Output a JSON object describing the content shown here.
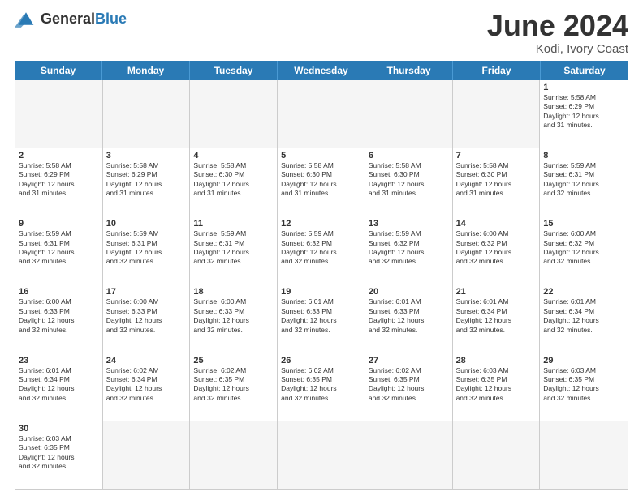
{
  "header": {
    "logo_general": "General",
    "logo_blue": "Blue",
    "month_title": "June 2024",
    "location": "Kodi, Ivory Coast"
  },
  "days_of_week": [
    "Sunday",
    "Monday",
    "Tuesday",
    "Wednesday",
    "Thursday",
    "Friday",
    "Saturday"
  ],
  "rows": [
    [
      {
        "day": "",
        "info": "",
        "empty": true
      },
      {
        "day": "",
        "info": "",
        "empty": true
      },
      {
        "day": "",
        "info": "",
        "empty": true
      },
      {
        "day": "",
        "info": "",
        "empty": true
      },
      {
        "day": "",
        "info": "",
        "empty": true
      },
      {
        "day": "",
        "info": "",
        "empty": true
      },
      {
        "day": "1",
        "info": "Sunrise: 5:58 AM\nSunset: 6:29 PM\nDaylight: 12 hours\nand 31 minutes.",
        "empty": false
      }
    ],
    [
      {
        "day": "2",
        "info": "Sunrise: 5:58 AM\nSunset: 6:29 PM\nDaylight: 12 hours\nand 31 minutes.",
        "empty": false
      },
      {
        "day": "3",
        "info": "Sunrise: 5:58 AM\nSunset: 6:29 PM\nDaylight: 12 hours\nand 31 minutes.",
        "empty": false
      },
      {
        "day": "4",
        "info": "Sunrise: 5:58 AM\nSunset: 6:30 PM\nDaylight: 12 hours\nand 31 minutes.",
        "empty": false
      },
      {
        "day": "5",
        "info": "Sunrise: 5:58 AM\nSunset: 6:30 PM\nDaylight: 12 hours\nand 31 minutes.",
        "empty": false
      },
      {
        "day": "6",
        "info": "Sunrise: 5:58 AM\nSunset: 6:30 PM\nDaylight: 12 hours\nand 31 minutes.",
        "empty": false
      },
      {
        "day": "7",
        "info": "Sunrise: 5:58 AM\nSunset: 6:30 PM\nDaylight: 12 hours\nand 31 minutes.",
        "empty": false
      },
      {
        "day": "8",
        "info": "Sunrise: 5:59 AM\nSunset: 6:31 PM\nDaylight: 12 hours\nand 32 minutes.",
        "empty": false
      }
    ],
    [
      {
        "day": "9",
        "info": "Sunrise: 5:59 AM\nSunset: 6:31 PM\nDaylight: 12 hours\nand 32 minutes.",
        "empty": false
      },
      {
        "day": "10",
        "info": "Sunrise: 5:59 AM\nSunset: 6:31 PM\nDaylight: 12 hours\nand 32 minutes.",
        "empty": false
      },
      {
        "day": "11",
        "info": "Sunrise: 5:59 AM\nSunset: 6:31 PM\nDaylight: 12 hours\nand 32 minutes.",
        "empty": false
      },
      {
        "day": "12",
        "info": "Sunrise: 5:59 AM\nSunset: 6:32 PM\nDaylight: 12 hours\nand 32 minutes.",
        "empty": false
      },
      {
        "day": "13",
        "info": "Sunrise: 5:59 AM\nSunset: 6:32 PM\nDaylight: 12 hours\nand 32 minutes.",
        "empty": false
      },
      {
        "day": "14",
        "info": "Sunrise: 6:00 AM\nSunset: 6:32 PM\nDaylight: 12 hours\nand 32 minutes.",
        "empty": false
      },
      {
        "day": "15",
        "info": "Sunrise: 6:00 AM\nSunset: 6:32 PM\nDaylight: 12 hours\nand 32 minutes.",
        "empty": false
      }
    ],
    [
      {
        "day": "16",
        "info": "Sunrise: 6:00 AM\nSunset: 6:33 PM\nDaylight: 12 hours\nand 32 minutes.",
        "empty": false
      },
      {
        "day": "17",
        "info": "Sunrise: 6:00 AM\nSunset: 6:33 PM\nDaylight: 12 hours\nand 32 minutes.",
        "empty": false
      },
      {
        "day": "18",
        "info": "Sunrise: 6:00 AM\nSunset: 6:33 PM\nDaylight: 12 hours\nand 32 minutes.",
        "empty": false
      },
      {
        "day": "19",
        "info": "Sunrise: 6:01 AM\nSunset: 6:33 PM\nDaylight: 12 hours\nand 32 minutes.",
        "empty": false
      },
      {
        "day": "20",
        "info": "Sunrise: 6:01 AM\nSunset: 6:33 PM\nDaylight: 12 hours\nand 32 minutes.",
        "empty": false
      },
      {
        "day": "21",
        "info": "Sunrise: 6:01 AM\nSunset: 6:34 PM\nDaylight: 12 hours\nand 32 minutes.",
        "empty": false
      },
      {
        "day": "22",
        "info": "Sunrise: 6:01 AM\nSunset: 6:34 PM\nDaylight: 12 hours\nand 32 minutes.",
        "empty": false
      }
    ],
    [
      {
        "day": "23",
        "info": "Sunrise: 6:01 AM\nSunset: 6:34 PM\nDaylight: 12 hours\nand 32 minutes.",
        "empty": false
      },
      {
        "day": "24",
        "info": "Sunrise: 6:02 AM\nSunset: 6:34 PM\nDaylight: 12 hours\nand 32 minutes.",
        "empty": false
      },
      {
        "day": "25",
        "info": "Sunrise: 6:02 AM\nSunset: 6:35 PM\nDaylight: 12 hours\nand 32 minutes.",
        "empty": false
      },
      {
        "day": "26",
        "info": "Sunrise: 6:02 AM\nSunset: 6:35 PM\nDaylight: 12 hours\nand 32 minutes.",
        "empty": false
      },
      {
        "day": "27",
        "info": "Sunrise: 6:02 AM\nSunset: 6:35 PM\nDaylight: 12 hours\nand 32 minutes.",
        "empty": false
      },
      {
        "day": "28",
        "info": "Sunrise: 6:03 AM\nSunset: 6:35 PM\nDaylight: 12 hours\nand 32 minutes.",
        "empty": false
      },
      {
        "day": "29",
        "info": "Sunrise: 6:03 AM\nSunset: 6:35 PM\nDaylight: 12 hours\nand 32 minutes.",
        "empty": false
      }
    ],
    [
      {
        "day": "30",
        "info": "Sunrise: 6:03 AM\nSunset: 6:35 PM\nDaylight: 12 hours\nand 32 minutes.",
        "empty": false
      },
      {
        "day": "",
        "info": "",
        "empty": true
      },
      {
        "day": "",
        "info": "",
        "empty": true
      },
      {
        "day": "",
        "info": "",
        "empty": true
      },
      {
        "day": "",
        "info": "",
        "empty": true
      },
      {
        "day": "",
        "info": "",
        "empty": true
      },
      {
        "day": "",
        "info": "",
        "empty": true
      }
    ]
  ]
}
